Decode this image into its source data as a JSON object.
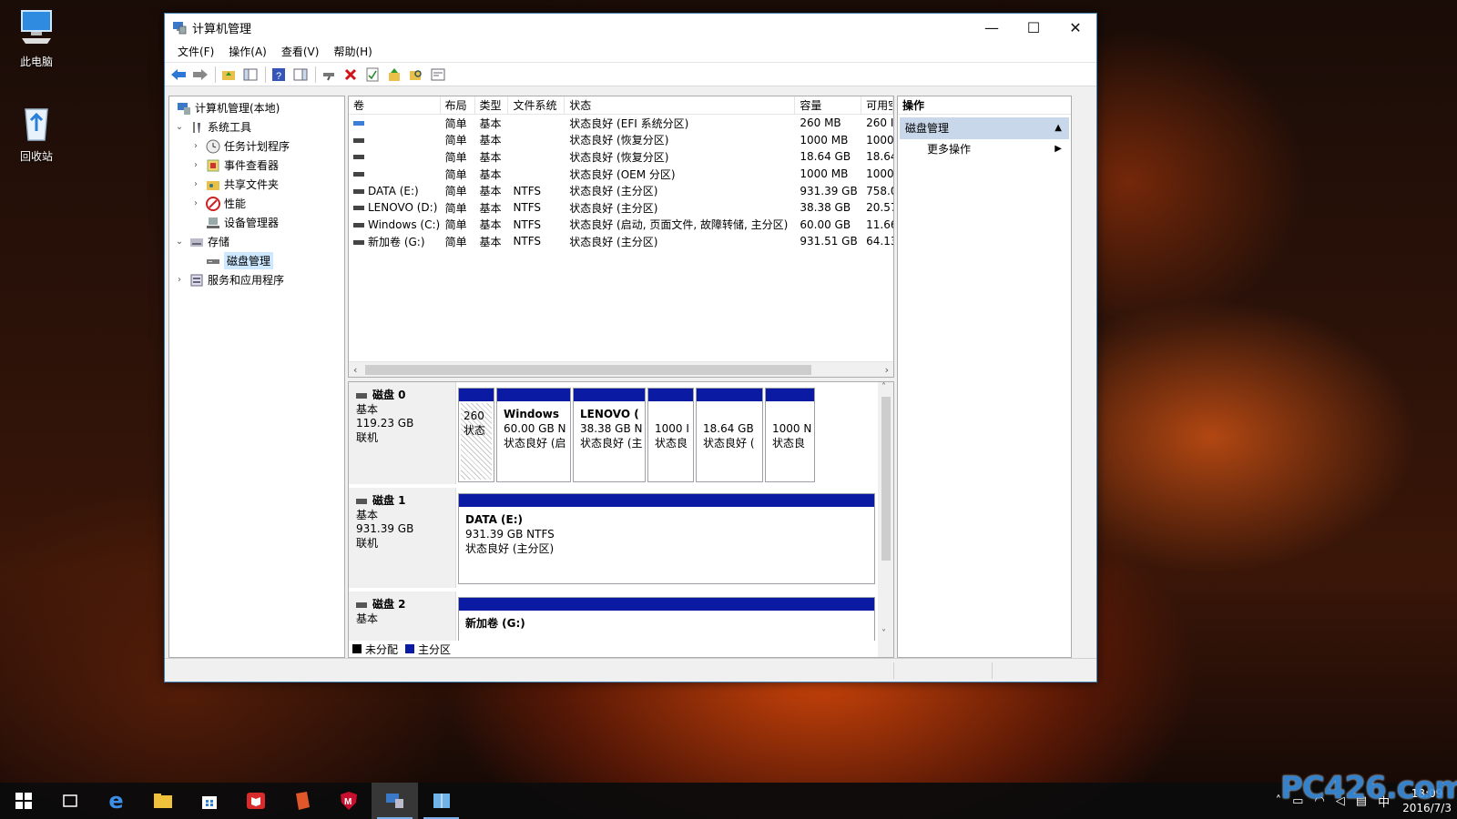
{
  "desktop": {
    "icons": [
      {
        "label": "此电脑"
      },
      {
        "label": "回收站"
      }
    ]
  },
  "window": {
    "title": "计算机管理",
    "controls": {
      "minimize": "—",
      "maximize": "☐",
      "close": "✕"
    },
    "menu": [
      "文件(F)",
      "操作(A)",
      "查看(V)",
      "帮助(H)"
    ]
  },
  "tree": {
    "root": "计算机管理(本地)",
    "system_tools": "系统工具",
    "task_scheduler": "任务计划程序",
    "event_viewer": "事件查看器",
    "shared_folders": "共享文件夹",
    "performance": "性能",
    "device_manager": "设备管理器",
    "storage": "存储",
    "disk_management": "磁盘管理",
    "services_apps": "服务和应用程序"
  },
  "volumes": {
    "headers": [
      "卷",
      "布局",
      "类型",
      "文件系统",
      "状态",
      "容量",
      "可用空"
    ],
    "rows": [
      [
        "",
        "简单",
        "基本",
        "",
        "状态良好 (EFI 系统分区)",
        "260 MB",
        "260 I"
      ],
      [
        "",
        "简单",
        "基本",
        "",
        "状态良好 (恢复分区)",
        "1000 MB",
        "1000"
      ],
      [
        "",
        "简单",
        "基本",
        "",
        "状态良好 (恢复分区)",
        "18.64 GB",
        "18.64"
      ],
      [
        "",
        "简单",
        "基本",
        "",
        "状态良好 (OEM 分区)",
        "1000 MB",
        "1000"
      ],
      [
        "DATA (E:)",
        "简单",
        "基本",
        "NTFS",
        "状态良好 (主分区)",
        "931.39 GB",
        "758.0"
      ],
      [
        "LENOVO (D:)",
        "简单",
        "基本",
        "NTFS",
        "状态良好 (主分区)",
        "38.38 GB",
        "20.57"
      ],
      [
        "Windows (C:)",
        "简单",
        "基本",
        "NTFS",
        "状态良好 (启动, 页面文件, 故障转储, 主分区)",
        "60.00 GB",
        "11.66"
      ],
      [
        "新加卷 (G:)",
        "简单",
        "基本",
        "NTFS",
        "状态良好 (主分区)",
        "931.51 GB",
        "64.13"
      ]
    ]
  },
  "disks": {
    "disk0": {
      "name": "磁盘 0",
      "type": "基本",
      "size": "119.23 GB",
      "status": "联机",
      "partitions": [
        {
          "name": "",
          "line1": "260",
          "line2": "状态"
        },
        {
          "name": "Windows",
          "line1": "60.00 GB N",
          "line2": "状态良好 (启"
        },
        {
          "name": "LENOVO (",
          "line1": "38.38 GB N",
          "line2": "状态良好 (主"
        },
        {
          "name": "",
          "line1": "1000 I",
          "line2": "状态良"
        },
        {
          "name": "",
          "line1": "18.64 GB",
          "line2": "状态良好 ("
        },
        {
          "name": "",
          "line1": "1000 N",
          "line2": "状态良"
        }
      ]
    },
    "disk1": {
      "name": "磁盘 1",
      "type": "基本",
      "size": "931.39 GB",
      "status": "联机",
      "partition": {
        "name": "DATA  (E:)",
        "line1": "931.39 GB NTFS",
        "line2": "状态良好 (主分区)"
      }
    },
    "disk2": {
      "name": "磁盘 2",
      "type": "基本",
      "partition": {
        "name": "新加卷 (G:)"
      }
    },
    "legend": [
      {
        "label": "未分配",
        "color": "#000000"
      },
      {
        "label": "主分区",
        "color": "#0a1aa3"
      }
    ]
  },
  "actions": {
    "header": "操作",
    "section": "磁盘管理",
    "more": "更多操作"
  },
  "taskbar": {
    "clock_time": "18:09",
    "clock_date": "2016/7/3"
  },
  "watermark": "PC426.com"
}
